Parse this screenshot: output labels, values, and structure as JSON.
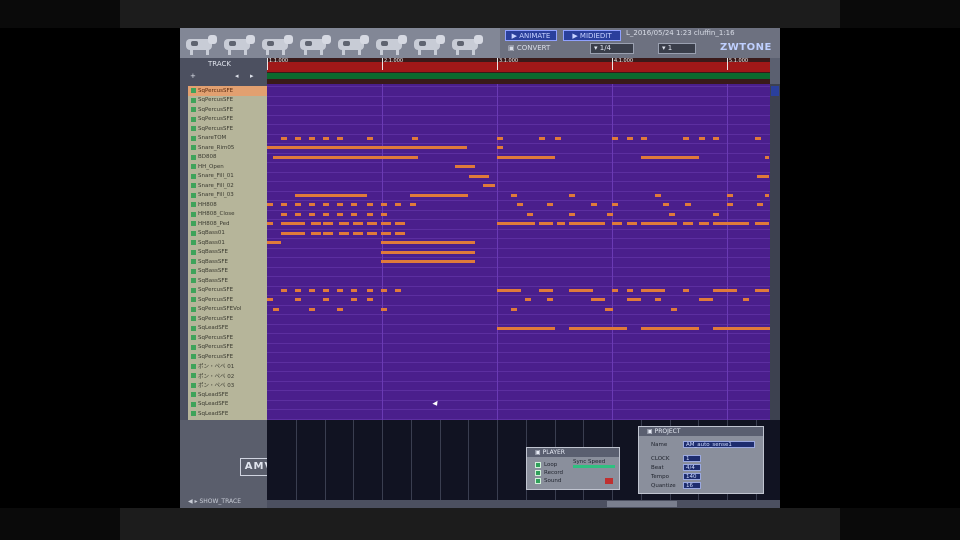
{
  "header": {
    "btn_1": "▶ ANIMATE",
    "btn_2": "▶ MIDIEDIT",
    "convert": "▣ CONVERT",
    "drop_1": "▾ 1/4",
    "drop_2": "▾ 1",
    "title_info": "L_2016/05/24 1:23 cluffin_1:16",
    "brand": "ZWTONE"
  },
  "sidebar": {
    "top_label": "TRACK",
    "tracks": [
      {
        "name": "SqPercusSFE",
        "selected": true
      },
      {
        "name": "SqPercusSFE"
      },
      {
        "name": "SqPercusSFE"
      },
      {
        "name": "SqPercusSFE"
      },
      {
        "name": "SqPercusSFE"
      },
      {
        "name": "SnareTOM"
      },
      {
        "name": "Snare_Rim05"
      },
      {
        "name": "BD808"
      },
      {
        "name": "HH_Open"
      },
      {
        "name": "Snare_Fill_01"
      },
      {
        "name": "Snare_Fill_02"
      },
      {
        "name": "Snare_Fill_03"
      },
      {
        "name": "HH808"
      },
      {
        "name": "HH808_Close"
      },
      {
        "name": "HH808_Ped"
      },
      {
        "name": "SqBass01"
      },
      {
        "name": "SqBass01"
      },
      {
        "name": "SqBassSFE"
      },
      {
        "name": "SqBassSFE"
      },
      {
        "name": "SqBassSFE"
      },
      {
        "name": "SqBassSFE"
      },
      {
        "name": "SqPercusSFE"
      },
      {
        "name": "SqPercusSFE"
      },
      {
        "name": "SqPercusSFEVol"
      },
      {
        "name": "SqPercusSFE"
      },
      {
        "name": "SqLeadSFE"
      },
      {
        "name": "SqPercusSFE"
      },
      {
        "name": "SqPercusSFE"
      },
      {
        "name": "SqPercusSFE"
      },
      {
        "name": "ポン・ペペ 01"
      },
      {
        "name": "ポン・ペペ 02"
      },
      {
        "name": "ポン・ペペ 03"
      },
      {
        "name": "SqLeadSFE"
      },
      {
        "name": "SqLeadSFE"
      },
      {
        "name": "SqLeadSFE"
      }
    ]
  },
  "ruler": {
    "labels": [
      "1.1.000",
      "2.1.000",
      "3.1.000",
      "4.1.000",
      "5.1.000"
    ]
  },
  "lower": {
    "logo": "AMV",
    "status": "◀ ▸ SHOW_TRACE"
  },
  "mixer_panel": {
    "title": "▣ PLAYER",
    "row1": "Loop",
    "row2": "Record",
    "row3": "Sound",
    "param_label": "Sync Speed"
  },
  "project_panel": {
    "title": "▣ PROJECT",
    "name_label": "Name",
    "name_value": "AM_auto_sense1",
    "r1_label": "CLOCK",
    "r1_value": "1",
    "r2_label": "Beat",
    "r2_value": "4/4",
    "r3_label": "Tempo",
    "r3_value": "140",
    "r4_label": "Quantize",
    "r4_value": "16"
  },
  "colors": {
    "roll_bg": "#4a1f8c",
    "note": "#e07a3a",
    "track_bg": "#b6b59a",
    "ruler_red": "#a01818",
    "ruler_green": "#0c6a2e"
  }
}
